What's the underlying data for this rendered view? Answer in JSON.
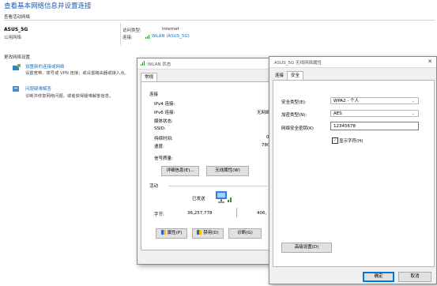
{
  "page": {
    "title": "查看基本网络信息并设置连接",
    "active_networks_label": "查看活动网络",
    "network_name": "ASUS_5G",
    "network_type": "公用网络",
    "access_type_label": "访问类型:",
    "access_type_value": "Internet",
    "connection_label": "连接:",
    "connection_value": "WLAN (ASUS_5G)",
    "change_settings_label": "更改网络设置",
    "tasks": [
      {
        "title": "设置新的连接或网络",
        "desc": "设置宽带、拨号或 VPN 连接；或设置路由器或接入点。"
      },
      {
        "title": "问题疑难解答",
        "desc": "诊断并修复网络问题，或者获得疑难解答信息。"
      }
    ]
  },
  "wlan_status": {
    "title": "WLAN 状态",
    "tab": "常规",
    "connection_section": "连接",
    "rows": [
      {
        "label": "IPv4 连接:",
        "value": ""
      },
      {
        "label": "IPv6 连接:",
        "value": "无网络"
      },
      {
        "label": "媒体状态:",
        "value": ""
      },
      {
        "label": "SSID:",
        "value": ""
      },
      {
        "label": "持续时间:",
        "value": "0"
      },
      {
        "label": "速度:",
        "value": "780"
      }
    ],
    "signal_label": "信号质量:",
    "details_button": "详细信息(E)...",
    "wireless_props_button": "无线属性(W)",
    "activity_section": "活动",
    "sent_label": "已发送",
    "bytes_label": "字节:",
    "bytes_sent": "36,257,778",
    "bytes_received": "406,",
    "properties_button": "属性(P)",
    "disable_button": "禁用(D)",
    "diagnose_button": "诊断(G)"
  },
  "wireless_props": {
    "title": "ASUS_5G 无线网络属性",
    "close_icon": "close-icon",
    "tabs": [
      "连接",
      "安全"
    ],
    "security_type_label": "安全类型(E):",
    "security_type_value": "WPA2 - 个人",
    "encryption_type_label": "加密类型(N):",
    "encryption_type_value": "AES",
    "key_label": "网络安全密钥(K)",
    "key_value": "12345678",
    "show_chars_label": "显示字符(H)",
    "show_chars_checked": true,
    "advanced_button": "高级设置(D)",
    "ok_button": "确定",
    "cancel_button": "取消"
  }
}
